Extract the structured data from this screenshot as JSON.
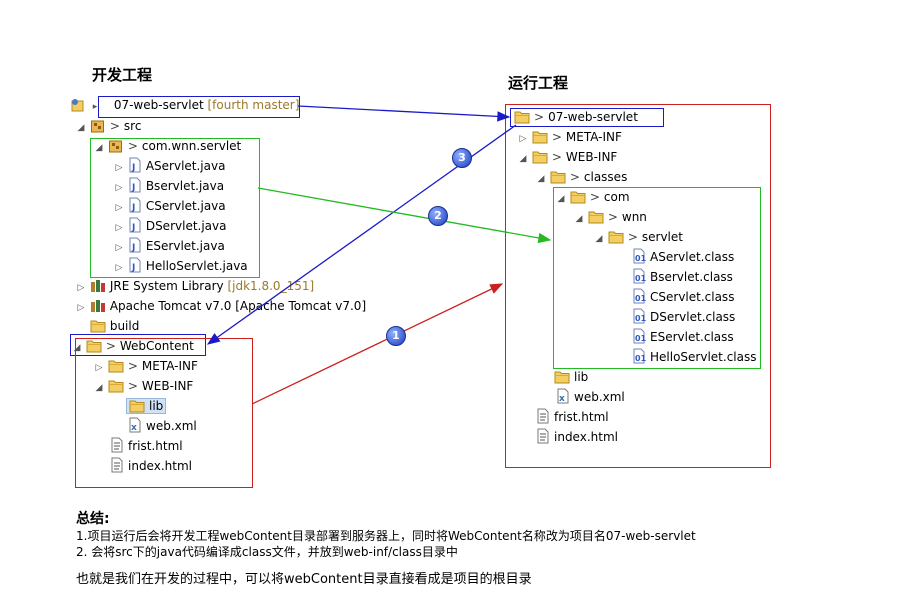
{
  "titles": {
    "dev": "开发工程",
    "run": "运行工程"
  },
  "left_tree": {
    "project": "07-web-servlet",
    "project_deco": "[fourth master]",
    "src": "src",
    "package": "com.wnn.servlet",
    "files": [
      "AServlet.java",
      "Bservlet.java",
      "CServlet.java",
      "DServlet.java",
      "EServlet.java",
      "HelloServlet.java"
    ],
    "jre": "JRE System Library",
    "jre_deco": "[jdk1.8.0_151]",
    "tomcat": "Apache Tomcat v7.0 [Apache Tomcat v7.0]",
    "build": "build",
    "webcontent": "WebContent",
    "meta_inf": "META-INF",
    "web_inf": "WEB-INF",
    "lib": "lib",
    "web_xml": "web.xml",
    "frist": "frist.html",
    "index": "index.html"
  },
  "right_tree": {
    "project": "07-web-servlet",
    "meta_inf": "META-INF",
    "web_inf": "WEB-INF",
    "classes": "classes",
    "com": "com",
    "wnn": "wnn",
    "servlet": "servlet",
    "class_files": [
      "AServlet.class",
      "Bservlet.class",
      "CServlet.class",
      "DServlet.class",
      "EServlet.class",
      "HelloServlet.class"
    ],
    "lib": "lib",
    "web_xml": "web.xml",
    "frist": "frist.html",
    "index": "index.html"
  },
  "markers": [
    "1",
    "2",
    "3"
  ],
  "colors": {
    "red": "#cc2020",
    "green": "#22bb22",
    "blue": "#1a1ac8"
  },
  "summary": {
    "heading": "总结:",
    "line1": "1.项目运行后会将开发工程webContent目录部署到服务器上，同时将WebContent名称改为项目名07-web-servlet",
    "line2": "2. 会将src下的java代码编译成class文件，并放到web-inf/class目录中",
    "line3": "也就是我们在开发的过程中，可以将webContent目录直接看成是项目的根目录"
  }
}
